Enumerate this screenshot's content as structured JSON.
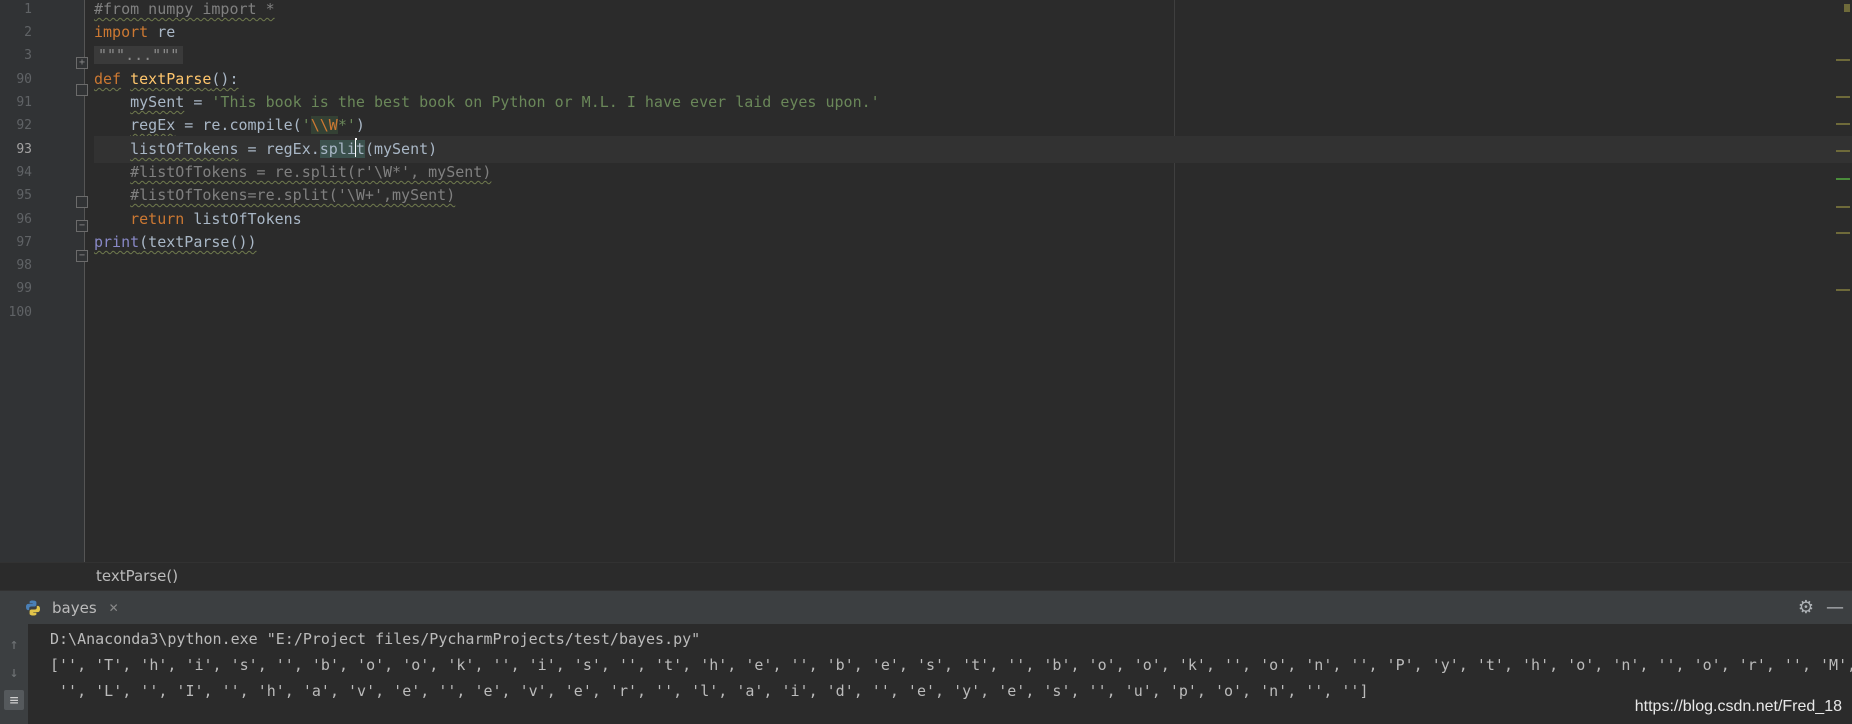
{
  "editor": {
    "line_numbers": [
      "1",
      "2",
      "3",
      "90",
      "91",
      "92",
      "93",
      "94",
      "95",
      "96",
      "97",
      "98",
      "99",
      "100"
    ],
    "current_line": "93",
    "code": {
      "l1_comment": "#from numpy import *",
      "l2_kw": "import",
      "l2_mod": " re",
      "l3_folded": "\"\"\"...\"\"\"",
      "l90_kw": "def",
      "l90_fn": "textParse",
      "l90_rest": "():",
      "l91_var": "mySent",
      "l91_op": " = ",
      "l91_str": "'This book is the best book on Python or M.L. I have ever laid eyes upon.'",
      "l92_var": "regEx",
      "l92_mid": " = re.compile(",
      "l92_q1": "'",
      "l92_esc": "\\\\W",
      "l92_tail": "*'",
      "l92_close": ")",
      "l93_var": "listOfTokens",
      "l93_mid": " = regEx.",
      "l93_split_a": "spli",
      "l93_split_b": "t",
      "l93_rest": "(mySent)",
      "l94_comment": "#listOfTokens = re.split(r'\\W*', mySent)",
      "l95_comment": "#listOfTokens=re.split('\\W+',mySent)",
      "l96_kw": "return",
      "l96_rest": " listOfTokens",
      "l97_bi": "print",
      "l97_rest": "(textParse())"
    }
  },
  "breadcrumb": {
    "item": "textParse()"
  },
  "run_panel": {
    "tab_label": "bayes",
    "icons": {
      "tab": "python-icon",
      "close": "close-icon",
      "settings": "gear-icon",
      "minimize": "minimize-icon",
      "up": "arrow-up-icon",
      "down": "arrow-down-icon",
      "wrap": "soft-wrap-icon"
    },
    "console": {
      "line1": "D:\\Anaconda3\\python.exe \"E:/Project files/PycharmProjects/test/bayes.py\"",
      "line2": "['', 'T', 'h', 'i', 's', '', 'b', 'o', 'o', 'k', '', 'i', 's', '', 't', 'h', 'e', '', 'b', 'e', 's', 't', '', 'b', 'o', 'o', 'k', '', 'o', 'n', '', 'P', 'y', 't', 'h', 'o', 'n', '', 'o', 'r', '', 'M',",
      "line3": " '', 'L', '', 'I', '', 'h', 'a', 'v', 'e', '', 'e', 'v', 'e', 'r', '', 'l', 'a', 'i', 'd', '', 'e', 'y', 'e', 's', '', 'u', 'p', 'o', 'n', '', '']"
    }
  },
  "watermark": "https://blog.csdn.net/Fred_18",
  "colors": {
    "background": "#2b2b2b",
    "keyword": "#cc7832",
    "function": "#ffc66d",
    "string": "#6a8759",
    "comment": "#808080",
    "builtin": "#8888c6"
  }
}
